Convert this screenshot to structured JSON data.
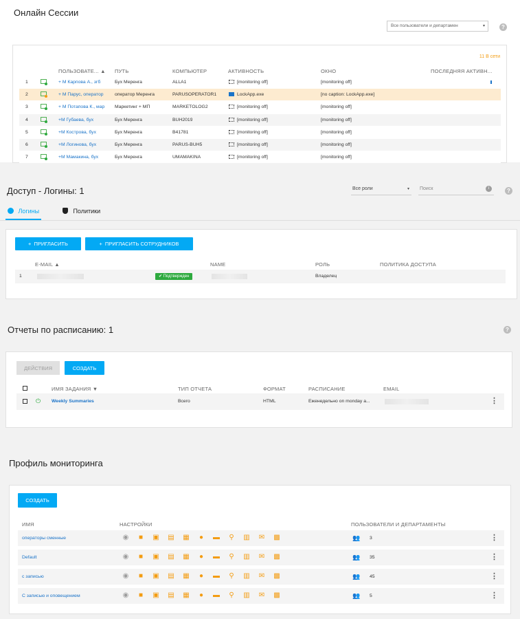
{
  "sessions": {
    "title": "Онлайн Сессии",
    "filter_placeholder": "Все пользователи и департамен",
    "online_count": "11 В сети",
    "columns": [
      "ПОЛЬЗОВАТЕ... ▲",
      "ПУТЬ",
      "КОМПЬЮТЕР",
      "АКТИВНОСТЬ",
      "ОКНО",
      "ПОСЛЕДНЯЯ АКТИВН..."
    ],
    "rows": [
      {
        "n": "1",
        "user": "+ M Карпова А., згб",
        "path": "Бух Меренга",
        "pc": "ALLA1",
        "activity": "[monitoring off]",
        "window": "[monitoring off]",
        "status": "green"
      },
      {
        "n": "2",
        "user": "+ M Парус, оператор",
        "path": "оператор Меренга",
        "pc": "PARUSOPERATOR1",
        "activity": "LockApp.exe",
        "window": "[no caption: LockApp.exe]",
        "status": "orange"
      },
      {
        "n": "3",
        "user": "+ M Потапова К., мар",
        "path": "Маркетинг + МП",
        "pc": "MARKETOLOG2",
        "activity": "[monitoring off]",
        "window": "[monitoring off]",
        "status": "green"
      },
      {
        "n": "4",
        "user": "+M Губаева, бух",
        "path": "Бух Меренга",
        "pc": "BUH2019",
        "activity": "[monitoring off]",
        "window": "[monitoring off]",
        "status": "green"
      },
      {
        "n": "5",
        "user": "+M Кострова, бух",
        "path": "Бух Меренга",
        "pc": "B41781",
        "activity": "[monitoring off]",
        "window": "[monitoring off]",
        "status": "green"
      },
      {
        "n": "6",
        "user": "+M Логинова, бух",
        "path": "Бух Меренга",
        "pc": "PARUS-BUH5",
        "activity": "[monitoring off]",
        "window": "[monitoring off]",
        "status": "green"
      },
      {
        "n": "7",
        "user": "+M Мамакина, бух",
        "path": "Бух Меренга",
        "pc": "UMAMAKINA",
        "activity": "[monitoring off]",
        "window": "[monitoring off]",
        "status": "green"
      }
    ]
  },
  "access": {
    "title": "Доступ - Логины: 1",
    "roles_select": "Все роли",
    "search_placeholder": "Поиск",
    "tabs": [
      "Логины",
      "Политики"
    ],
    "invite": "ПРИГЛАСИТЬ",
    "invite_staff": "ПРИГЛАСИТЬ СОТРУДНИКОВ",
    "columns": [
      "E-MAIL ▲",
      "NAME",
      "РОЛЬ",
      "ПОЛИТИКА ДОСТУПА"
    ],
    "row": {
      "n": "1",
      "badge": "Подтвержден",
      "role": "Владелец"
    }
  },
  "reports": {
    "title": "Отчеты по расписанию: 1",
    "actions": "ДЕЙСТВИЯ",
    "create": "СОЗДАТЬ",
    "columns": [
      "ИМЯ ЗАДАНИЯ ▼",
      "ТИП ОТЧЕТА",
      "ФОРМАТ",
      "РАСПИСАНИЕ",
      "EMAIL"
    ],
    "row": {
      "name": "Weekly Summaries",
      "type": "Всего",
      "format": "HTML",
      "schedule": "Еженедельно on monday a..."
    }
  },
  "profiles": {
    "title": "Профиль мониторинга",
    "create": "СОЗДАТЬ",
    "columns": [
      "ИМЯ",
      "НАСТРОЙКИ",
      "ПОЛЬЗОВАТЕЛИ И ДЕПАРТАМЕНТЫ"
    ],
    "rows": [
      {
        "name": "операторы сменные",
        "count": "3"
      },
      {
        "name": "Default",
        "count": "35"
      },
      {
        "name": "с записью",
        "count": "45"
      },
      {
        "name": "С записью и оповещением",
        "count": "5"
      }
    ],
    "setting_icons": [
      "eye-icon",
      "video-icon",
      "camera-icon",
      "keyboard-icon",
      "apps-icon",
      "globe-icon",
      "folder-icon",
      "search-icon",
      "document-icon",
      "mail-icon",
      "print-icon"
    ]
  },
  "colors": {
    "accent": "#03a9f4",
    "link": "#1a73c8",
    "orange": "#f39c12",
    "selected_row": "#fdebd0",
    "badge": "#2eaa3f"
  }
}
